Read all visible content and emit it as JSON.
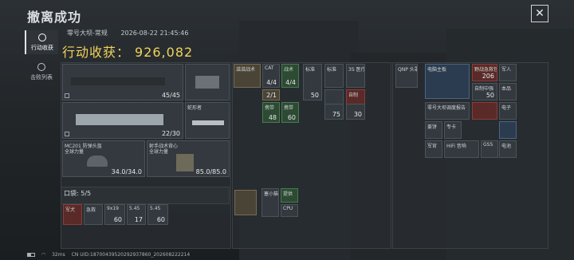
{
  "header": {
    "title": "撤离成功",
    "close_icon": "close-icon"
  },
  "sidebar": {
    "tabs": [
      {
        "label": "行动收获",
        "icon": "target-icon",
        "active": true
      },
      {
        "label": "击败列表",
        "icon": "skull-icon",
        "active": false
      }
    ]
  },
  "meta": {
    "map": "零号大坝-常规",
    "datetime": "2026-08-22 21:45:46"
  },
  "harvest": {
    "label": "行动收获：",
    "value": "926,082"
  },
  "weapons": {
    "primary1_count": "45/45",
    "primary2_count": "22/30",
    "melee_label": "蛇形者",
    "helmet_label": "MC201 防弹头盔",
    "helmet_sub": "全球力量",
    "helmet_value": "34.0/34.0",
    "armor_label": "射手战术背心",
    "armor_sub": "全球力量",
    "armor_value": "85.0/85.0"
  },
  "rig": {
    "items": [
      {
        "label": "滋滋战术",
        "num": ""
      },
      {
        "label": "CAT",
        "num": "4/4"
      },
      {
        "label": "战术",
        "num": "4/4"
      },
      {
        "label": "标准",
        "num": "50"
      },
      {
        "label": "标准",
        "num": ""
      },
      {
        "label": "3S 医疗",
        "num": ""
      },
      {
        "label": "",
        "num": "2/1"
      },
      {
        "label": "",
        "num": ""
      },
      {
        "label": "",
        "num": ""
      },
      {
        "label": "",
        "num": ""
      },
      {
        "label": "自制",
        "num": ""
      },
      {
        "label": "携带",
        "num": "48"
      },
      {
        "label": "携带",
        "num": "60"
      },
      {
        "label": "",
        "num": "75"
      },
      {
        "label": "",
        "num": "30"
      }
    ]
  },
  "backpack": {
    "items": [
      {
        "label": "QNP 头罩",
        "num": ""
      },
      {
        "label": "电脑主板",
        "num": ""
      },
      {
        "label": "野战急救包",
        "num": "206"
      },
      {
        "label": "军人",
        "num": ""
      },
      {
        "label": "自制中强",
        "num": "50"
      },
      {
        "label": "本品",
        "num": ""
      },
      {
        "label": "零号大坝调度报告",
        "num": ""
      },
      {
        "label": "电子",
        "num": ""
      },
      {
        "label": "姜饼",
        "num": ""
      },
      {
        "label": "专卡",
        "num": ""
      },
      {
        "label": "HiFi 音响",
        "num": ""
      },
      {
        "label": "GSS",
        "num": ""
      },
      {
        "label": "军官",
        "num": ""
      },
      {
        "label": "电池",
        "num": ""
      }
    ]
  },
  "pocket": {
    "title": "口袋: 5/5",
    "items": [
      {
        "label": "军犬",
        "num": ""
      },
      {
        "label": "急救",
        "num": ""
      },
      {
        "label": "9x19",
        "num": "60"
      },
      {
        "label": "5.45",
        "num": "17"
      },
      {
        "label": "5.45",
        "num": "60"
      }
    ]
  },
  "safebox": {
    "items": [
      {
        "label": "",
        "num": ""
      },
      {
        "label": "塞小猫",
        "num": ""
      },
      {
        "label": "提供",
        "num": ""
      },
      {
        "label": "CPU",
        "num": ""
      }
    ]
  },
  "footer": {
    "ping": "32ms",
    "uid": "CN UID:18700439520292937860_202608222214"
  }
}
